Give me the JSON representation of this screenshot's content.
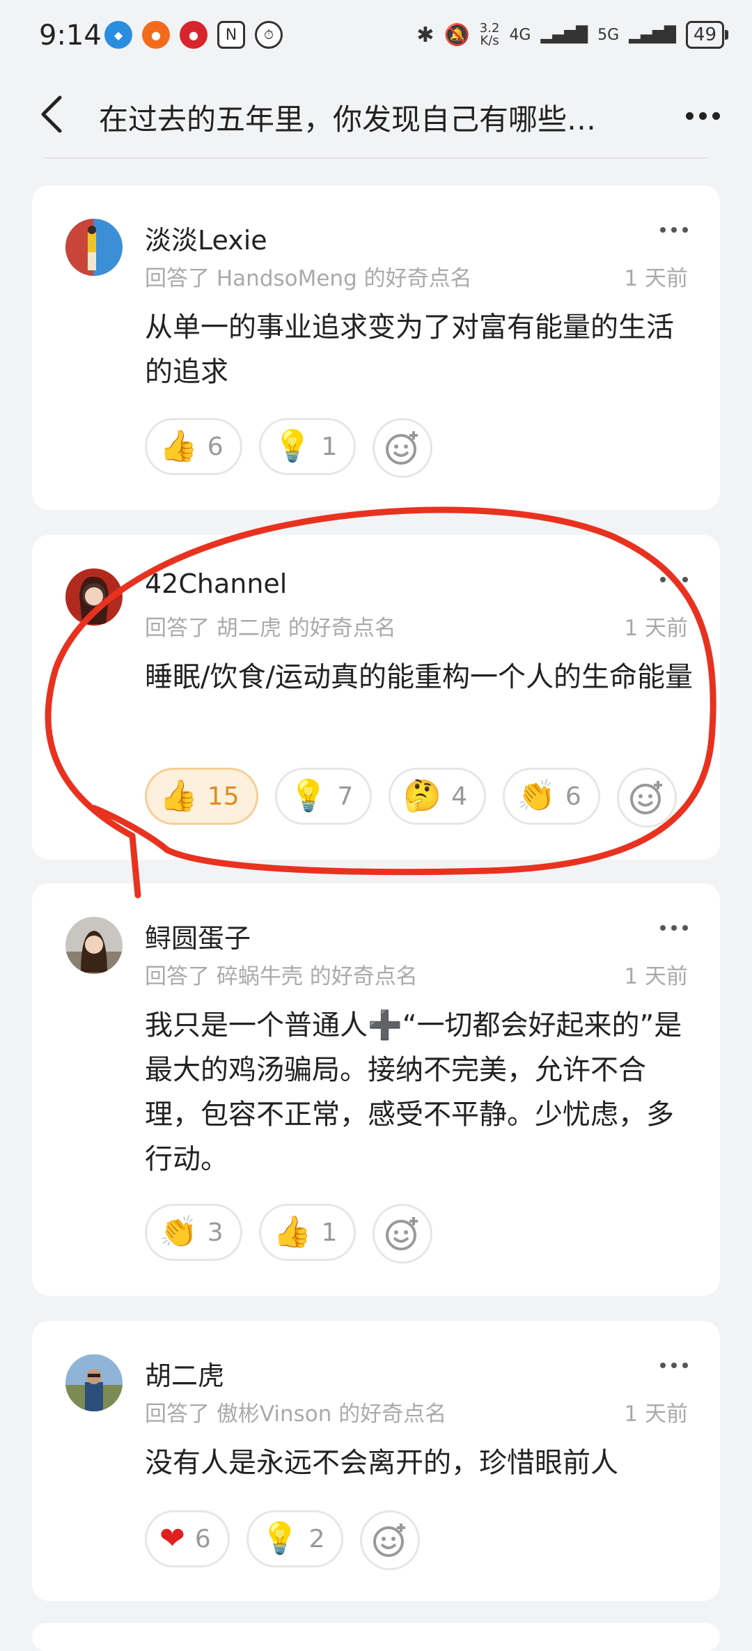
{
  "status_bar": {
    "time": "9:14",
    "net_speed_value": "3.2",
    "net_speed_unit": "K/s",
    "signal_1": "4G",
    "signal_2": "5G",
    "battery": "49"
  },
  "nav": {
    "title": "在过去的五年里，你发现自己有哪些…"
  },
  "answered_text": "回答了",
  "suffix_text": "的好奇点名",
  "posts": [
    {
      "author": "淡淡Lexie",
      "target": "HandsoMeng",
      "time": "1 天前",
      "content": "从单一的事业追求变为了对富有能量的生活的追求",
      "reactions": [
        {
          "icon": "thumbs-up",
          "emoji": "👍",
          "count": "6"
        },
        {
          "icon": "lightbulb",
          "emoji": "💡",
          "count": "1"
        }
      ]
    },
    {
      "author": "42Channel",
      "target": "胡二虎",
      "time": "1 天前",
      "content": "睡眠/饮食/运动真的能重构一个人的生命能量",
      "reactions": [
        {
          "icon": "thumbs-up",
          "emoji": "👍",
          "count": "15",
          "active": true
        },
        {
          "icon": "lightbulb",
          "emoji": "💡",
          "count": "7"
        },
        {
          "icon": "thinking-face",
          "emoji": "🤔",
          "count": "4"
        },
        {
          "icon": "clapping-hands",
          "emoji": "👏",
          "count": "6"
        }
      ]
    },
    {
      "author": "鲟圆蛋子",
      "target": "碎蜗牛壳",
      "time": "1 天前",
      "content": "我只是一个普通人➕“一切都会好起来的”是最大的鸡汤骗局。接纳不完美，允许不合理，包容不正常，感受不平静。少忧虑，多行动。",
      "reactions": [
        {
          "icon": "clapping-hands",
          "emoji": "👏",
          "count": "3"
        },
        {
          "icon": "thumbs-up",
          "emoji": "👍",
          "count": "1"
        }
      ]
    },
    {
      "author": "胡二虎",
      "target": "傲彬Vinson",
      "time": "1 天前",
      "content": "没有人是永远不会离开的，珍惜眼前人",
      "reactions": [
        {
          "icon": "heart",
          "emoji": "❤️",
          "count": "6"
        },
        {
          "icon": "lightbulb",
          "emoji": "💡",
          "count": "2"
        }
      ]
    }
  ],
  "colors": {
    "background": "#f2f3f5",
    "card": "#ffffff",
    "meta_text": "#aaaaaa",
    "active_reaction_bg": "#fdf0dc",
    "active_reaction_text": "#e08a1c",
    "annotation": "#e8321f"
  }
}
